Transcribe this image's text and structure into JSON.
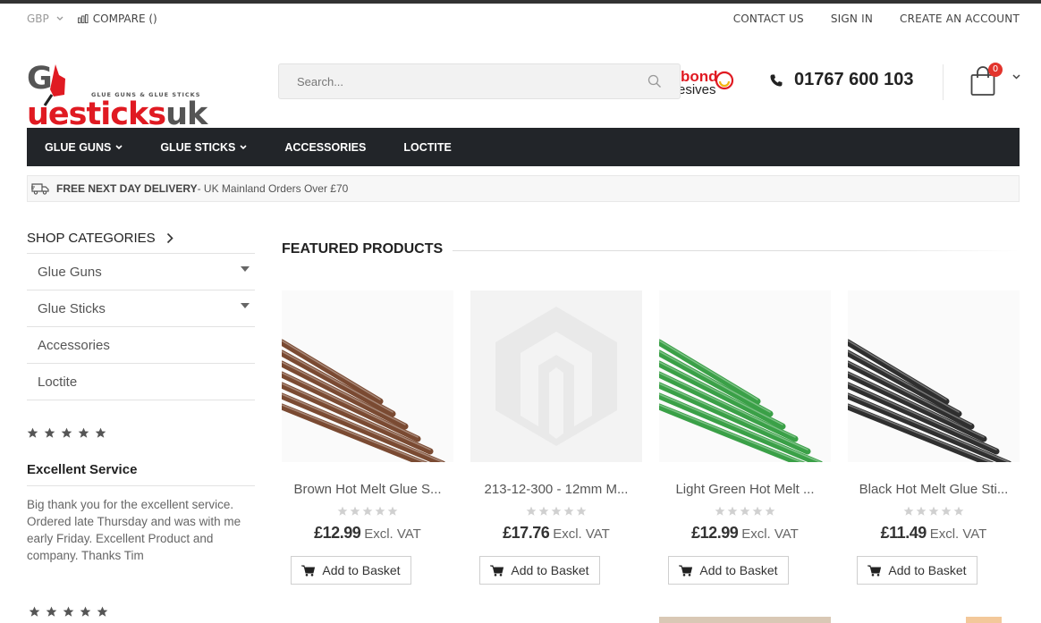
{
  "topbar": {
    "currency": "GBP",
    "compare": "COMPARE ()",
    "links": [
      "CONTACT US",
      "SIGN IN",
      "CREATE AN ACCOUNT"
    ]
  },
  "logo": {
    "prefix": "G",
    "mid": "ue",
    "rest": "sticks",
    "suffix": "uk",
    "tagline": "GLUE GUNS & GLUE STICKS"
  },
  "search": {
    "placeholder": "Search..."
  },
  "brand_partner": {
    "line1": "bond",
    "line2": "esives"
  },
  "phone": "01767 600 103",
  "cart": {
    "count": "0"
  },
  "nav": [
    "GLUE GUNS",
    "GLUE STICKS",
    "ACCESSORIES",
    "LOCTITE"
  ],
  "delivery": {
    "strong": "FREE NEXT DAY DELIVERY",
    "text": "- UK Mainland Orders Over £70"
  },
  "sidebar": {
    "title": "SHOP CATEGORIES",
    "categories": [
      "Glue Guns",
      "Glue Sticks",
      "Accessories",
      "Loctite"
    ],
    "review": {
      "title": "Excellent Service",
      "text": "Big thank you for the excellent service. Ordered late Thursday and was with me early Friday. Excellent Product and company. Thanks Tim"
    }
  },
  "featured": {
    "title": "FEATURED PRODUCTS",
    "products": [
      {
        "name": "Brown Hot Melt Glue S...",
        "price": "£12.99",
        "vat": "Excl. VAT",
        "button": "Add to Basket",
        "color": "#7a4a32",
        "rating": 0
      },
      {
        "name": "213-12-300 - 12mm M...",
        "price": "£17.76",
        "vat": "Excl. VAT",
        "button": "Add to Basket",
        "color": "placeholder",
        "rating": 0
      },
      {
        "name": "Light Green Hot Melt ...",
        "price": "£12.99",
        "vat": "Excl. VAT",
        "button": "Add to Basket",
        "color": "#3aa047",
        "rating": 0
      },
      {
        "name": "Black Hot Melt Glue Sti...",
        "price": "£11.49",
        "vat": "Excl. VAT",
        "button": "Add to Basket",
        "color": "#2f2f2f",
        "rating": 0
      }
    ]
  },
  "colors": {
    "nav_bg": "#222529",
    "brand_red": "#e01a22",
    "badge": "#e2342c"
  }
}
